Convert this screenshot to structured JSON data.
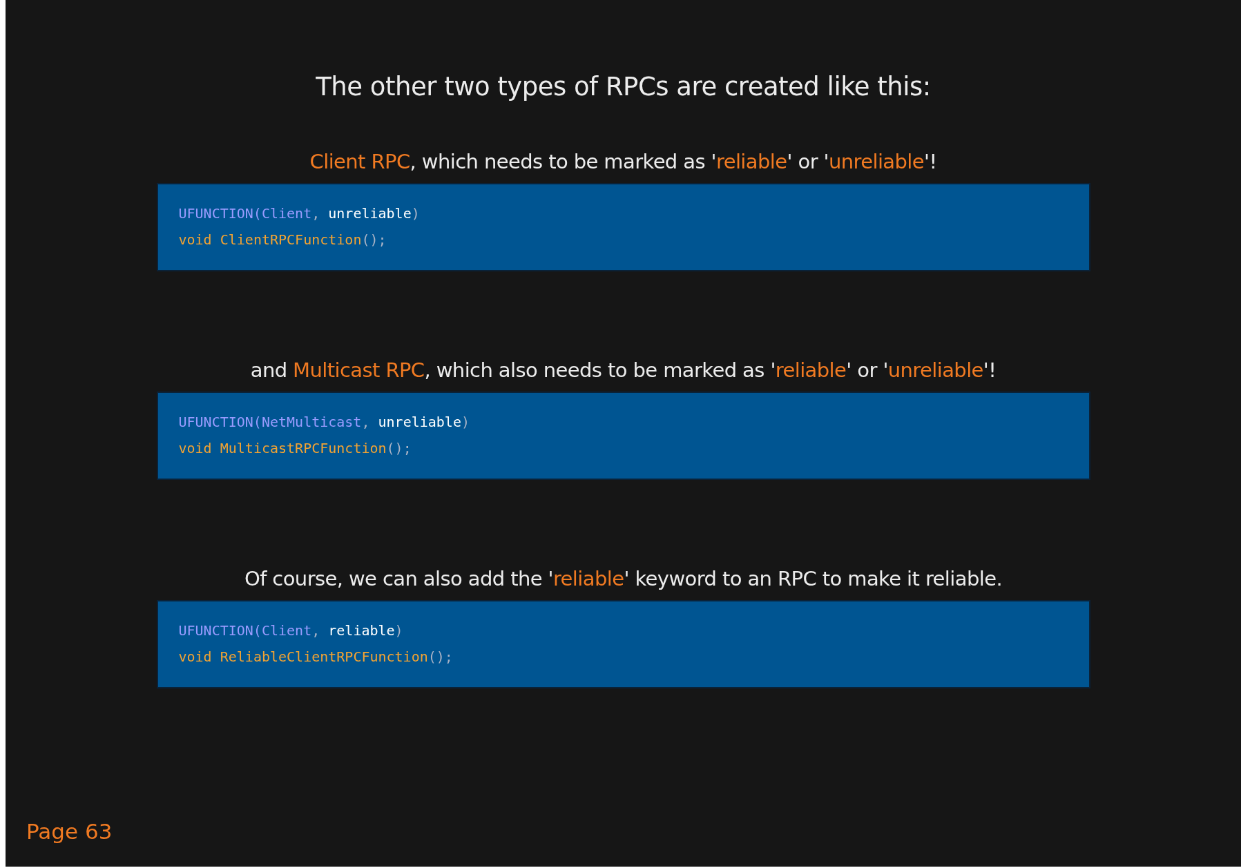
{
  "title": "The other two types of RPCs are created like this:",
  "sections": [
    {
      "heading": [
        {
          "text": "Client RPC",
          "highlight": true
        },
        {
          "text": ", which needs to be marked as '",
          "highlight": false
        },
        {
          "text": "reliable",
          "highlight": true
        },
        {
          "text": "' or '",
          "highlight": false
        },
        {
          "text": "unreliable",
          "highlight": true
        },
        {
          "text": "'!",
          "highlight": false
        }
      ],
      "code": [
        [
          {
            "text": "UFUNCTION(",
            "kind": "macro"
          },
          {
            "text": "Client",
            "kind": "macro"
          },
          {
            "text": ", ",
            "kind": "punct"
          },
          {
            "text": "unreliable",
            "kind": "plain"
          },
          {
            "text": ")",
            "kind": "punct"
          }
        ],
        [
          {
            "text": "void ",
            "kind": "keyword"
          },
          {
            "text": "ClientRPCFunction",
            "kind": "keyword"
          },
          {
            "text": "();",
            "kind": "punct"
          }
        ]
      ]
    },
    {
      "heading": [
        {
          "text": "and ",
          "highlight": false
        },
        {
          "text": "Multicast RPC",
          "highlight": true
        },
        {
          "text": ", which also needs to be marked as '",
          "highlight": false
        },
        {
          "text": "reliable",
          "highlight": true
        },
        {
          "text": "' or '",
          "highlight": false
        },
        {
          "text": "unreliable",
          "highlight": true
        },
        {
          "text": "'!",
          "highlight": false
        }
      ],
      "code": [
        [
          {
            "text": "UFUNCTION(",
            "kind": "macro"
          },
          {
            "text": "NetMulticast",
            "kind": "macro"
          },
          {
            "text": ", ",
            "kind": "punct"
          },
          {
            "text": "unreliable",
            "kind": "plain"
          },
          {
            "text": ")",
            "kind": "punct"
          }
        ],
        [
          {
            "text": "void ",
            "kind": "keyword"
          },
          {
            "text": "MulticastRPCFunction",
            "kind": "keyword"
          },
          {
            "text": "();",
            "kind": "punct"
          }
        ]
      ]
    },
    {
      "heading": [
        {
          "text": "Of course, we can also add the '",
          "highlight": false
        },
        {
          "text": "reliable",
          "highlight": true
        },
        {
          "text": "' keyword to an RPC to make it reliable.",
          "highlight": false
        }
      ],
      "code": [
        [
          {
            "text": "UFUNCTION(",
            "kind": "macro"
          },
          {
            "text": "Client",
            "kind": "macro"
          },
          {
            "text": ", ",
            "kind": "punct"
          },
          {
            "text": "reliable",
            "kind": "plain"
          },
          {
            "text": ")",
            "kind": "punct"
          }
        ],
        [
          {
            "text": "void ",
            "kind": "keyword"
          },
          {
            "text": "ReliableClientRPCFunction",
            "kind": "keyword"
          },
          {
            "text": "();",
            "kind": "punct"
          }
        ]
      ]
    }
  ],
  "page_number": "Page 63"
}
